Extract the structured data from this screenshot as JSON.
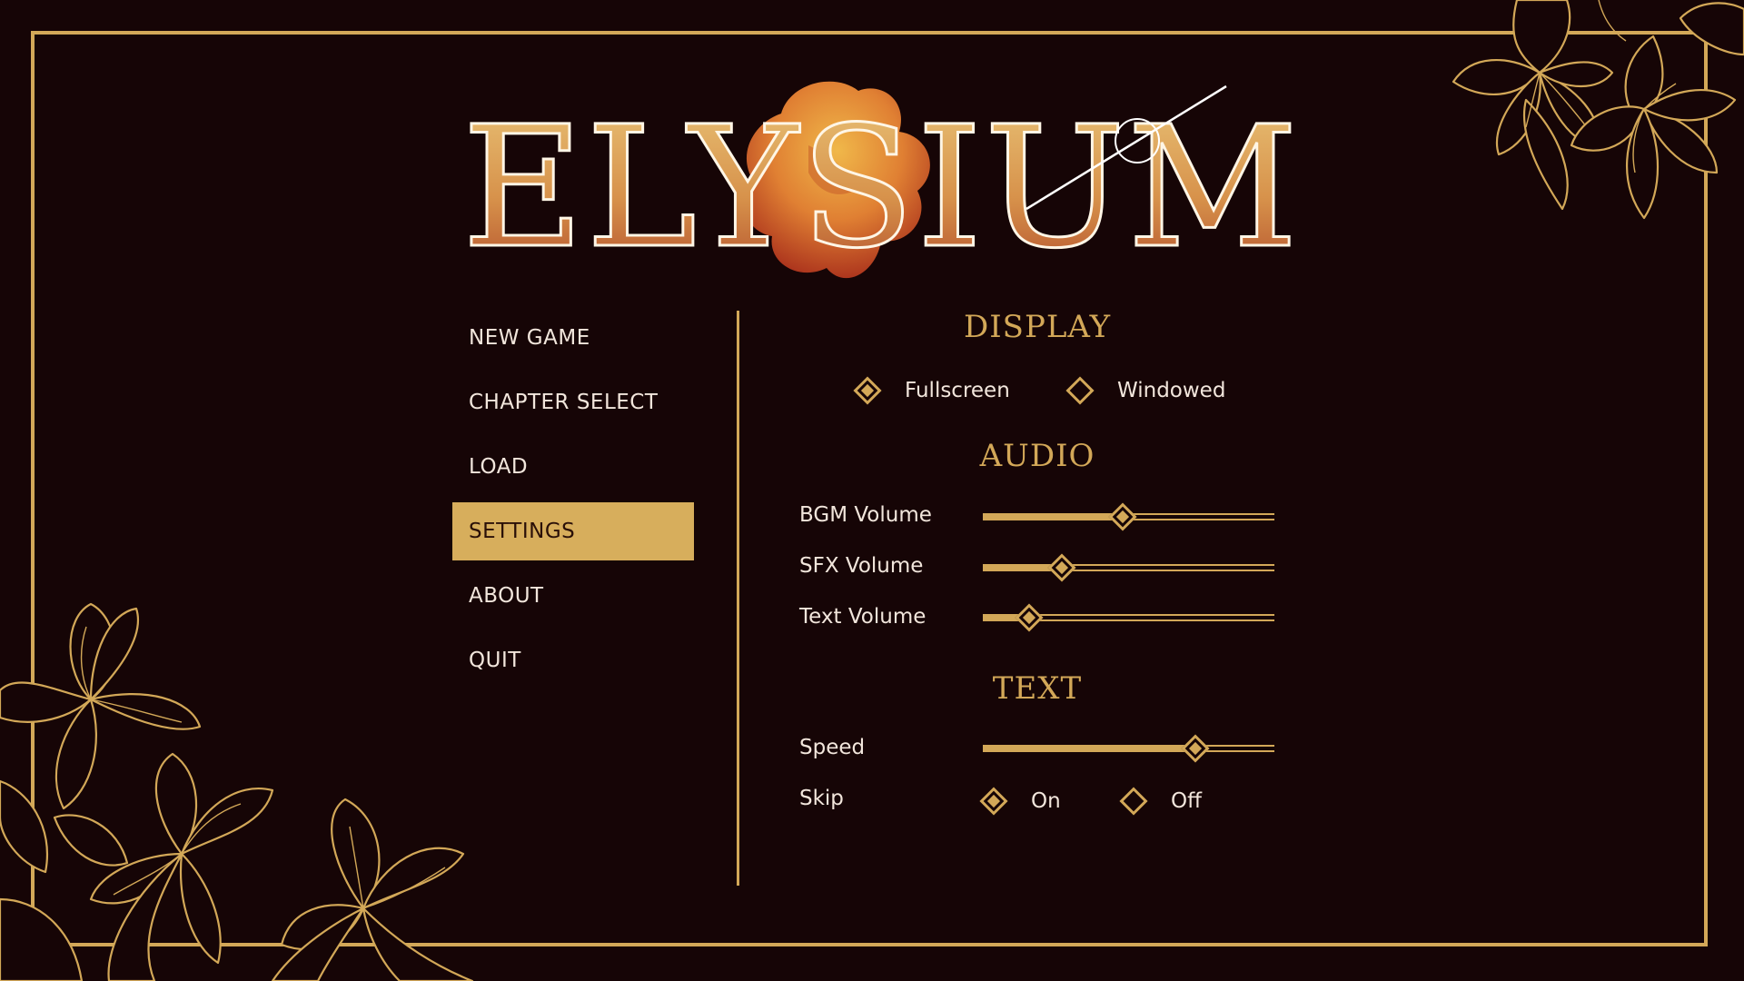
{
  "title": "ELYSIUM",
  "menu": {
    "items": [
      {
        "label": "NEW GAME"
      },
      {
        "label": "CHAPTER SELECT"
      },
      {
        "label": "LOAD"
      },
      {
        "label": "SETTINGS"
      },
      {
        "label": "ABOUT"
      },
      {
        "label": "QUIT"
      }
    ],
    "selected": "SETTINGS"
  },
  "settings": {
    "display": {
      "title": "DISPLAY",
      "fullscreen_label": "Fullscreen",
      "windowed_label": "Windowed",
      "selected": "Fullscreen"
    },
    "audio": {
      "title": "AUDIO",
      "bgm": {
        "label": "BGM Volume",
        "value": 0.48
      },
      "sfx": {
        "label": "SFX Volume",
        "value": 0.27
      },
      "text": {
        "label": "Text Volume",
        "value": 0.16
      }
    },
    "text": {
      "title": "TEXT",
      "speed": {
        "label": "Speed",
        "value": 0.73
      },
      "skip": {
        "label": "Skip",
        "on_label": "On",
        "off_label": "Off",
        "selected": "On"
      }
    }
  },
  "colors": {
    "background": "#160506",
    "gold": "#d3a858",
    "highlight": "#d7ae5c",
    "text": "#f2e6dc",
    "flower_orange": "#e0902f",
    "flower_red": "#a7301a"
  }
}
